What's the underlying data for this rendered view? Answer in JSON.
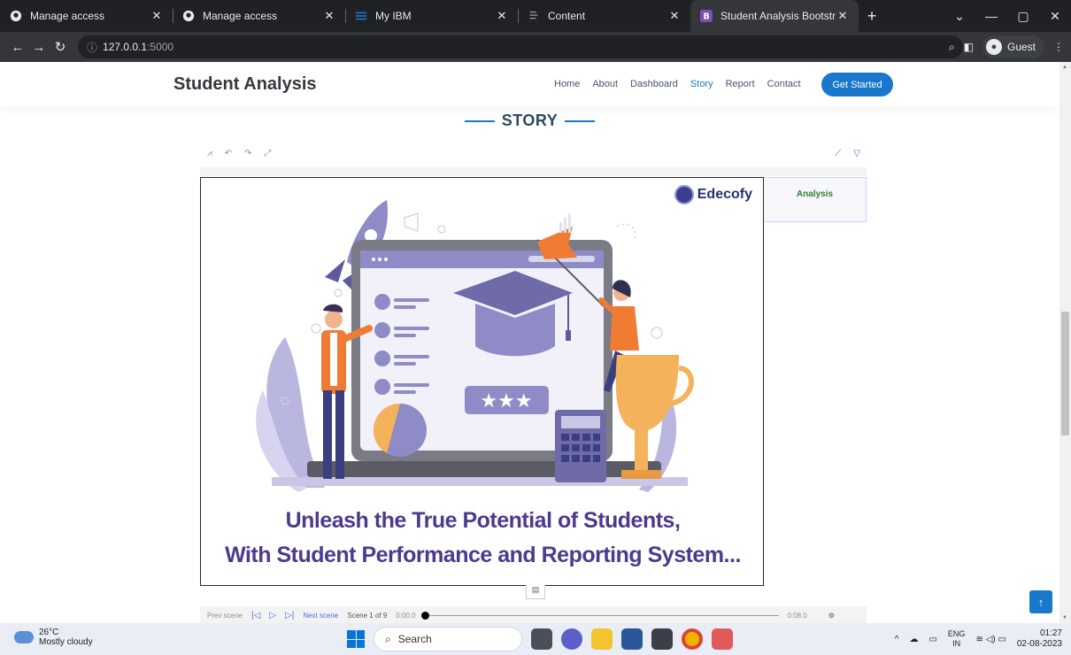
{
  "browser": {
    "tabs": [
      {
        "label": "Manage access",
        "icon": "github-icon"
      },
      {
        "label": "Manage access",
        "icon": "github-icon"
      },
      {
        "label": "My IBM",
        "icon": "ibm-icon"
      },
      {
        "label": "Content",
        "icon": "content-icon"
      },
      {
        "label": "Student Analysis Bootstrap Temp",
        "icon": "bootstrap-icon",
        "active": true
      }
    ],
    "url_host": "127.0.0.1",
    "url_port": ":5000",
    "profile": "Guest"
  },
  "site": {
    "brand": "Student Analysis",
    "menu": [
      "Home",
      "About",
      "Dashboard",
      "Story",
      "Report",
      "Contact"
    ],
    "active_menu": "Story",
    "cta": "Get Started",
    "section_title": "STORY"
  },
  "story": {
    "caption": "Analysis",
    "logo_text": "Edecofy",
    "headline_line1": "Unleash the True Potential of Students,",
    "headline_line2": "With Student Performance and Reporting System...",
    "player": {
      "prev": "Prev scene",
      "next": "Next scene",
      "scene_counter": "Scene 1 of 9",
      "time_start": "0:00.0",
      "time_end": "0:08.0",
      "progress": 0
    }
  },
  "taskbar": {
    "temperature": "26°C",
    "weather": "Mostly cloudy",
    "search": "Search",
    "lang1": "ENG",
    "lang2": "IN",
    "time": "01:27",
    "date": "02-08-2023"
  },
  "colors": {
    "accent": "#1977cc",
    "headline": "#4b3b8f",
    "illustration_purple": "#8f8bc6",
    "illustration_orange": "#f07c33"
  }
}
